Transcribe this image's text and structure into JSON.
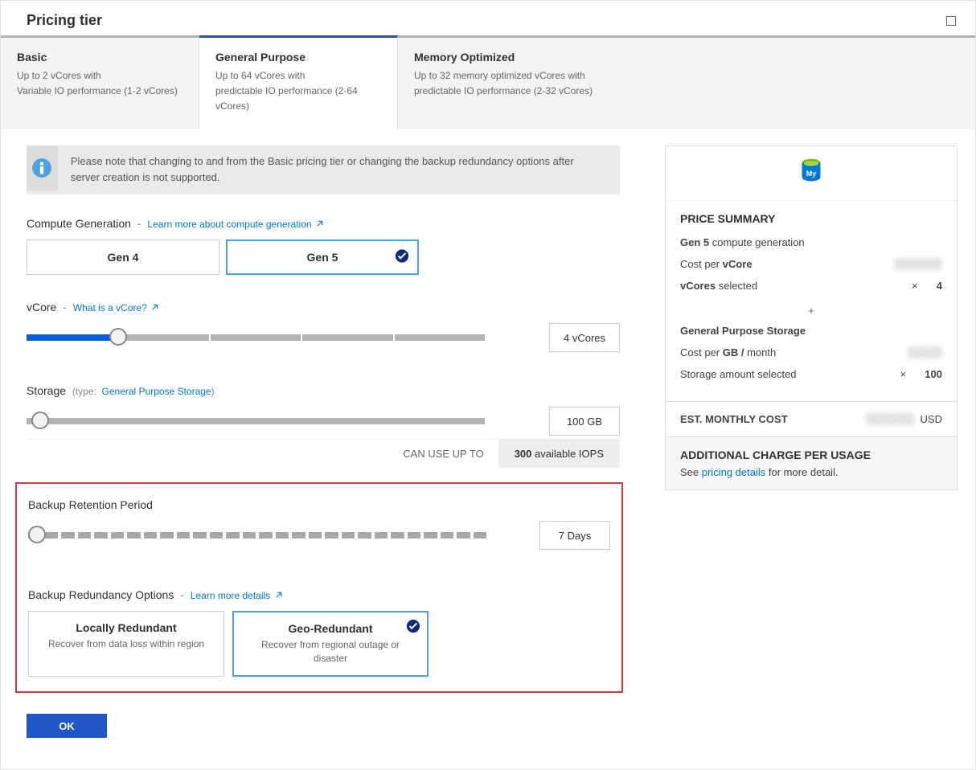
{
  "header": {
    "title": "Pricing tier"
  },
  "tabs": [
    {
      "title": "Basic",
      "line1": "Up to 2 vCores with",
      "line2": "Variable IO performance (1-2 vCores)"
    },
    {
      "title": "General Purpose",
      "line1": "Up to 64 vCores with",
      "line2": "predictable IO performance (2-64 vCores)"
    },
    {
      "title": "Memory Optimized",
      "line1": "Up to 32 memory optimized vCores with",
      "line2": "predictable IO performance (2-32 vCores)"
    }
  ],
  "info": "Please note that changing to and from the Basic pricing tier or changing the backup redundancy options after server creation is not supported.",
  "compute": {
    "label": "Compute Generation",
    "link": "Learn more about compute generation",
    "options": [
      "Gen 4",
      "Gen 5"
    ],
    "selected": "Gen 5"
  },
  "vcore": {
    "label": "vCore",
    "link": "What is a vCore?",
    "value_display": "4 vCores"
  },
  "storage": {
    "label": "Storage",
    "type_label": "(type:",
    "type_link": "General Purpose Storage",
    "type_close": ")",
    "value_display": "100 GB"
  },
  "iops": {
    "label": "CAN USE UP TO",
    "value_strong": "300",
    "value_rest": " available IOPS"
  },
  "backup_retention": {
    "label": "Backup Retention Period",
    "value_display": "7 Days"
  },
  "backup_redundancy": {
    "label": "Backup Redundancy Options",
    "link": "Learn more details",
    "options": [
      {
        "title": "Locally Redundant",
        "sub": "Recover from data loss within region"
      },
      {
        "title": "Geo-Redundant",
        "sub": "Recover from regional outage or disaster"
      }
    ],
    "selected": "Geo-Redundant"
  },
  "ok": "OK",
  "summary": {
    "title": "PRICE SUMMARY",
    "gen_line_strong": "Gen 5",
    "gen_line_rest": " compute generation",
    "cost_per_vcore_label_pre": "Cost per ",
    "cost_per_vcore_label_strong": "vCore",
    "vcores_selected_label_strong": "vCores",
    "vcores_selected_label_rest": " selected",
    "vcores_selected_mult": "×",
    "vcores_selected_value": "4",
    "storage_heading": "General Purpose Storage",
    "cost_per_gb_pre": "Cost per ",
    "cost_per_gb_strong": "GB /",
    "cost_per_gb_rest": " month",
    "storage_amount_label": "Storage amount selected",
    "storage_amount_mult": "×",
    "storage_amount_value": "100",
    "est_label": "EST. MONTHLY COST",
    "est_currency": "USD",
    "additional_title": "ADDITIONAL CHARGE PER USAGE",
    "additional_pre": "See ",
    "additional_link": "pricing details",
    "additional_post": " for more detail."
  }
}
